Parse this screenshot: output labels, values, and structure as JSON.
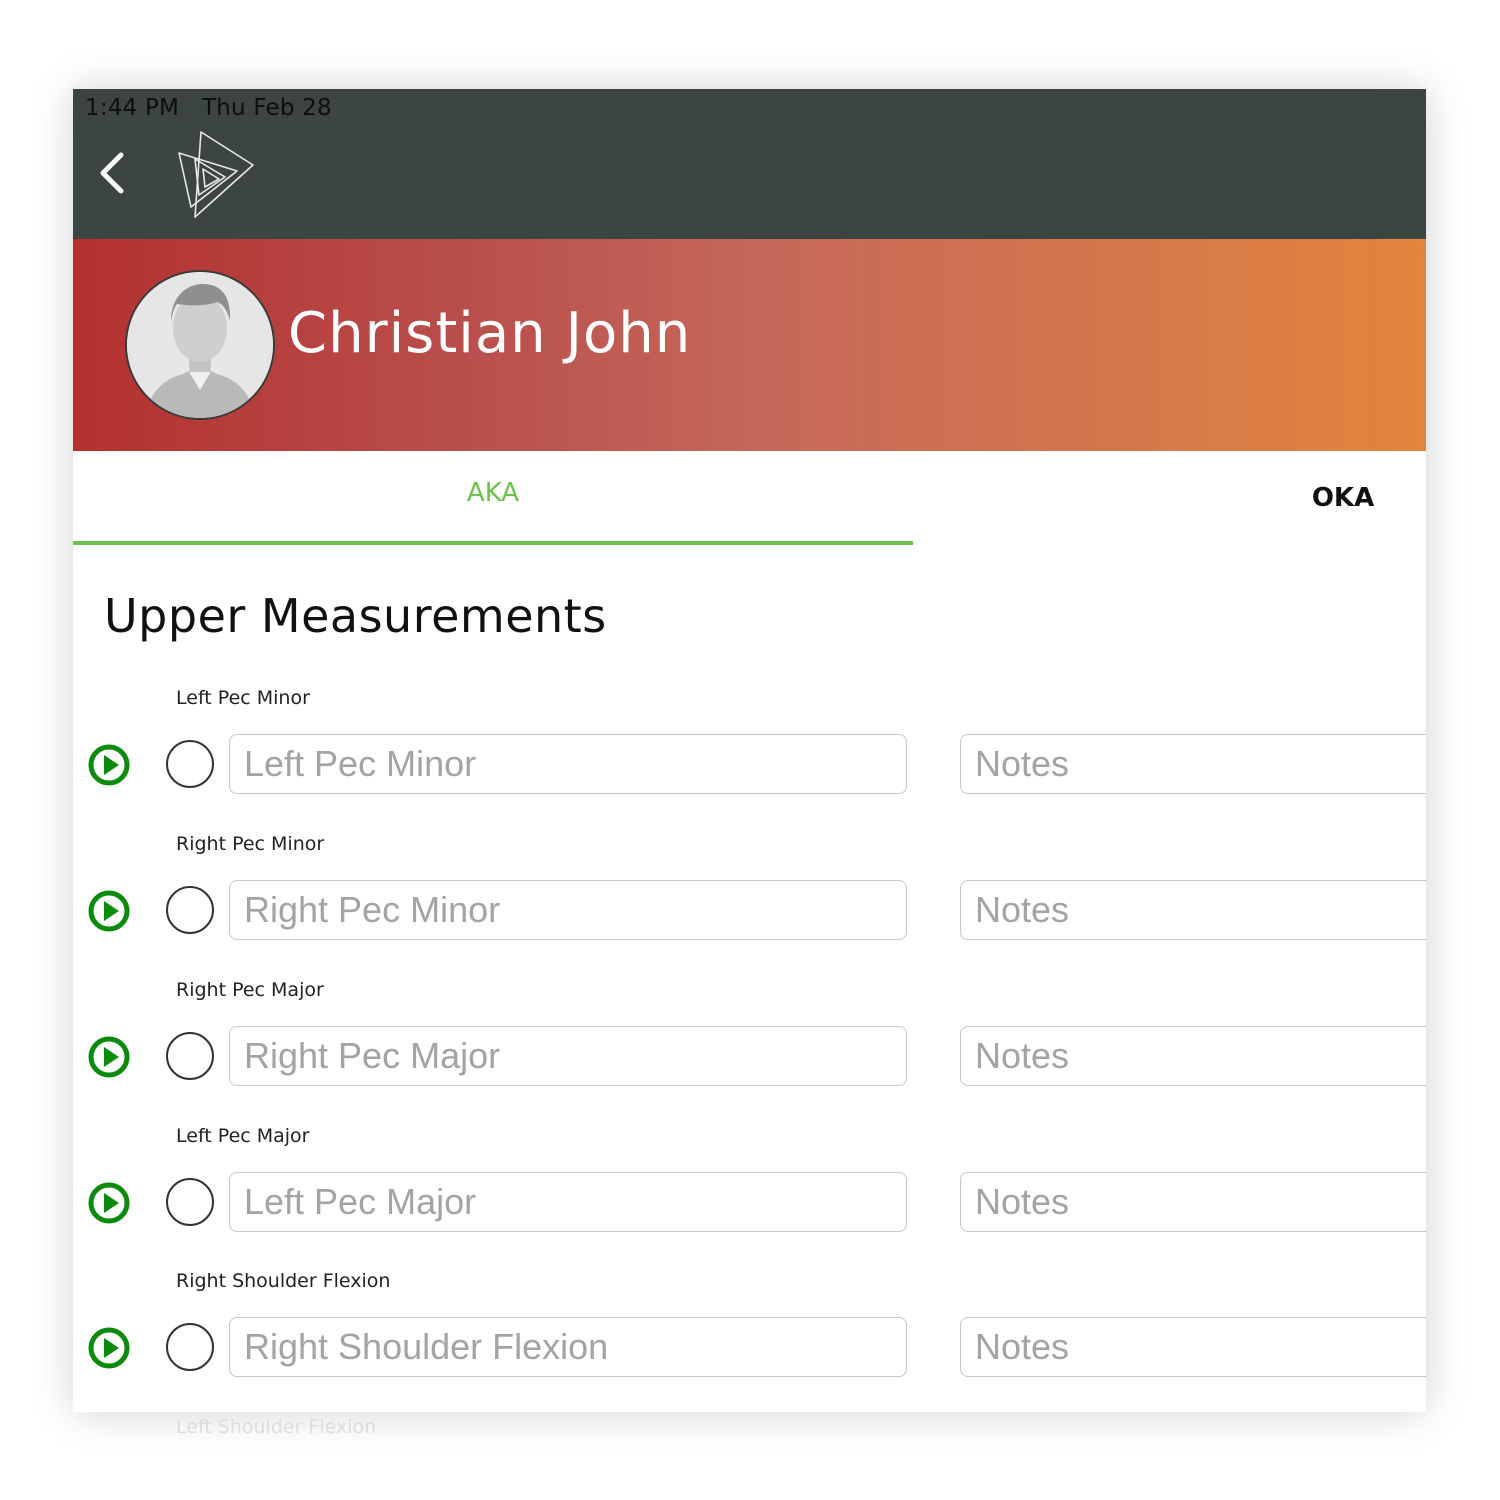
{
  "status_bar": {
    "time": "1:44 PM",
    "date": "Thu Feb 28"
  },
  "nav": {
    "back_icon": "chevron-left-icon",
    "logo_icon": "triangles-logo-icon"
  },
  "profile": {
    "name": "Christian John",
    "avatar_icon": "person-silhouette-icon"
  },
  "tabs": [
    {
      "label": "AKA",
      "active": true
    },
    {
      "label": "OKA",
      "active": false
    }
  ],
  "section": {
    "title": "Upper Measurements"
  },
  "measurements": [
    {
      "label": "Left Pec Minor",
      "placeholder": "Left Pec Minor",
      "notes_placeholder": "Notes"
    },
    {
      "label": "Right Pec Minor",
      "placeholder": "Right Pec Minor",
      "notes_placeholder": "Notes"
    },
    {
      "label": "Right Pec Major",
      "placeholder": "Right Pec Major",
      "notes_placeholder": "Notes"
    },
    {
      "label": "Left Pec Major",
      "placeholder": "Left Pec Major",
      "notes_placeholder": "Notes"
    },
    {
      "label": "Right Shoulder Flexion",
      "placeholder": "Right Shoulder Flexion",
      "notes_placeholder": "Notes"
    }
  ],
  "next_partial_label": "Left Shoulder Flexion",
  "colors": {
    "topbar": "#3c4541",
    "accent_green": "#6cc24a",
    "play_green": "#0b8a0b",
    "banner_start": "#b3312f",
    "banner_end": "#e3853c"
  }
}
